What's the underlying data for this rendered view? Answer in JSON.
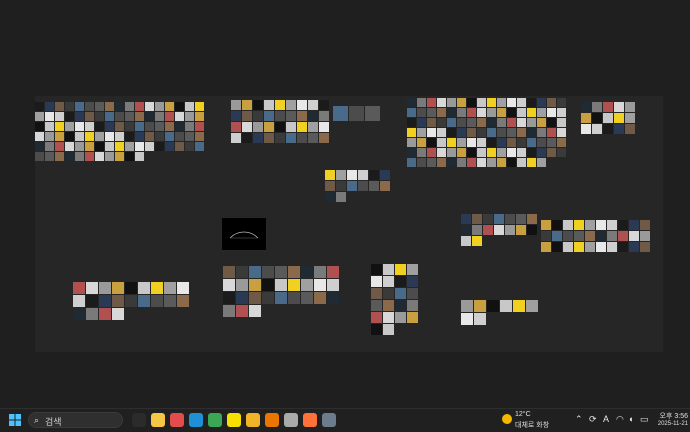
{
  "taskbar": {
    "search_placeholder": "검색",
    "apps": [
      {
        "name": "task-view",
        "color": "#2b2b2b"
      },
      {
        "name": "file-explorer",
        "color": "#f6c744"
      },
      {
        "name": "music",
        "color": "#e24c4c"
      },
      {
        "name": "edge",
        "color": "#1f8fd6"
      },
      {
        "name": "chrome",
        "color": "#3aa757"
      },
      {
        "name": "kakaotalk",
        "color": "#f7e000"
      },
      {
        "name": "folder",
        "color": "#f0b429"
      },
      {
        "name": "blender",
        "color": "#ea7600"
      },
      {
        "name": "unity-hub",
        "color": "#aaaaaa"
      },
      {
        "name": "firefox",
        "color": "#ff7139"
      },
      {
        "name": "steam",
        "color": "#6b7c8d"
      }
    ],
    "weather": {
      "temp": "12°C",
      "desc": "대체로 화창"
    },
    "tray_icons": [
      "chevron-up-icon",
      "sync-icon",
      "ime-icon",
      "wifi-icon",
      "volume-icon",
      "battery-icon"
    ],
    "ime_label": "A",
    "time": "오후 3:56",
    "date": "2025-11-21"
  },
  "palette": [
    "#1b1b1b",
    "#3a3a3a",
    "#5a5a5a",
    "#7a7a7a",
    "#9a9a9a",
    "#c8c8c8",
    "#e8e8e8",
    "#2a3a55",
    "#4a6a8a",
    "#8a6a4a",
    "#b05050",
    "#c8a040",
    "#f0d020",
    "#cfcfcf",
    "#6e5a46",
    "#4c4c4c",
    "#202a33",
    "#d8d8d8",
    "#111111",
    "#a0a0a0"
  ],
  "clusters": [
    {
      "name": "cluster-interior-large",
      "count": 96,
      "size": 9
    },
    {
      "name": "cluster-interior-steering",
      "count": 36,
      "size": 10
    },
    {
      "name": "cluster-logos",
      "count": 3,
      "size": 15
    },
    {
      "name": "cluster-tires",
      "count": 14,
      "size": 10
    },
    {
      "name": "cluster-exterior-cars",
      "count": 110,
      "size": 9
    },
    {
      "name": "cluster-wheels-set",
      "count": 28,
      "size": 10
    },
    {
      "name": "cluster-steering-wheels",
      "count": 22,
      "size": 12
    },
    {
      "name": "cluster-rims",
      "count": 30,
      "size": 12
    },
    {
      "name": "cluster-details",
      "count": 22,
      "size": 11
    },
    {
      "name": "cluster-parts-a",
      "count": 16,
      "size": 10
    },
    {
      "name": "cluster-parts-b",
      "count": 30,
      "size": 10
    },
    {
      "name": "cluster-parts-c",
      "count": 8,
      "size": 12
    }
  ],
  "photo_cards": [
    {
      "name": "dark-car-photo-card",
      "caption": ""
    }
  ]
}
